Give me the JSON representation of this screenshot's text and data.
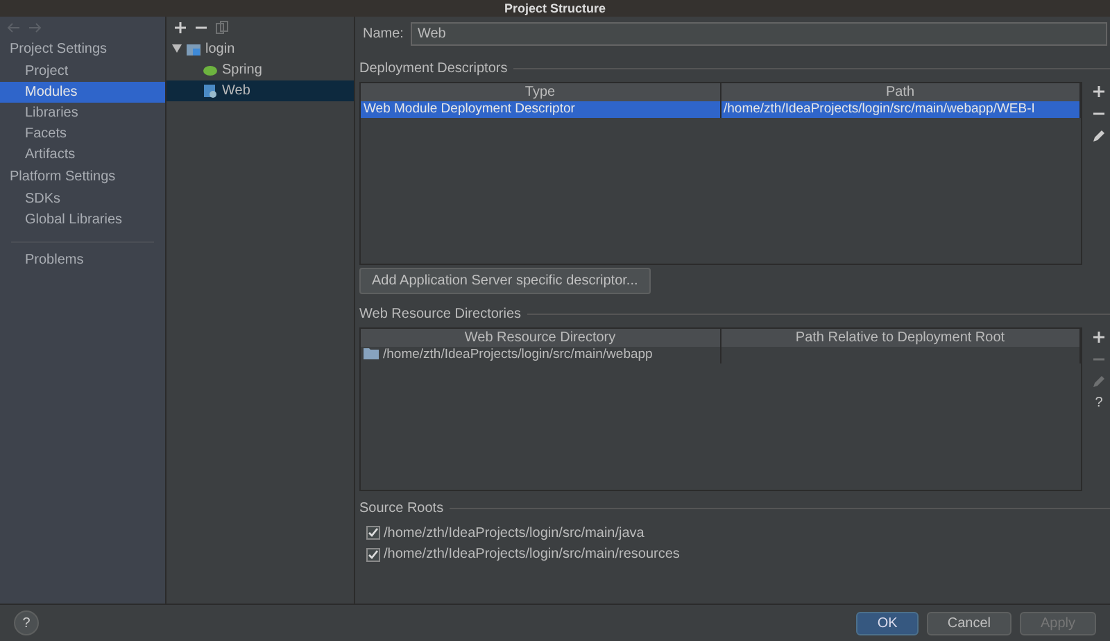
{
  "window": {
    "title": "Project Structure"
  },
  "sidebar": {
    "sections": [
      {
        "heading": "Project Settings",
        "items": [
          {
            "label": "Project",
            "selected": false
          },
          {
            "label": "Modules",
            "selected": true
          },
          {
            "label": "Libraries",
            "selected": false
          },
          {
            "label": "Facets",
            "selected": false
          },
          {
            "label": "Artifacts",
            "selected": false
          }
        ]
      },
      {
        "heading": "Platform Settings",
        "items": [
          {
            "label": "SDKs",
            "selected": false
          },
          {
            "label": "Global Libraries",
            "selected": false
          }
        ]
      }
    ],
    "extra_items": [
      {
        "label": "Problems",
        "selected": false
      }
    ]
  },
  "tree_toolbar": [
    {
      "kind": "add",
      "disabled": false
    },
    {
      "kind": "remove",
      "disabled": false
    },
    {
      "kind": "copy",
      "disabled": true
    }
  ],
  "tree": [
    {
      "label": "login",
      "kind": "module",
      "expanded": true,
      "selected": false,
      "children": [
        {
          "label": "Spring",
          "kind": "spring",
          "selected": false
        },
        {
          "label": "Web",
          "kind": "web",
          "selected": true
        }
      ]
    }
  ],
  "name_field": {
    "label": "Name:",
    "value": "Web"
  },
  "deployment_descriptors": {
    "heading": "Deployment Descriptors",
    "columns": [
      "Type",
      "Path"
    ],
    "rows": [
      {
        "cells": [
          "Web Module Deployment Descriptor",
          "/home/zth/IdeaProjects/login/src/main/webapp/WEB-I"
        ],
        "selected": true
      }
    ],
    "toolbar": [
      {
        "kind": "add",
        "disabled": false
      },
      {
        "kind": "remove",
        "disabled": false
      },
      {
        "kind": "edit",
        "disabled": false
      }
    ],
    "add_button": "Add Application Server specific descriptor..."
  },
  "web_resource_directories": {
    "heading": "Web Resource Directories",
    "columns": [
      "Web Resource Directory",
      "Path Relative to Deployment Root"
    ],
    "rows": [
      {
        "cells": [
          "/home/zth/IdeaProjects/login/src/main/webapp",
          ""
        ],
        "selected": false
      }
    ],
    "toolbar": [
      {
        "kind": "add",
        "disabled": false
      },
      {
        "kind": "remove",
        "disabled": true
      },
      {
        "kind": "edit",
        "disabled": true
      },
      {
        "kind": "help",
        "disabled": false,
        "label": "?"
      }
    ]
  },
  "source_roots": {
    "heading": "Source Roots",
    "items": [
      {
        "path": "/home/zth/IdeaProjects/login/src/main/java",
        "checked": true
      },
      {
        "path": "/home/zth/IdeaProjects/login/src/main/resources",
        "checked": true
      }
    ]
  },
  "footer": {
    "help": "?",
    "buttons": [
      {
        "label": "OK",
        "kind": "primary",
        "disabled": false
      },
      {
        "label": "Cancel",
        "kind": "normal",
        "disabled": false
      },
      {
        "label": "Apply",
        "kind": "normal",
        "disabled": true
      }
    ]
  }
}
